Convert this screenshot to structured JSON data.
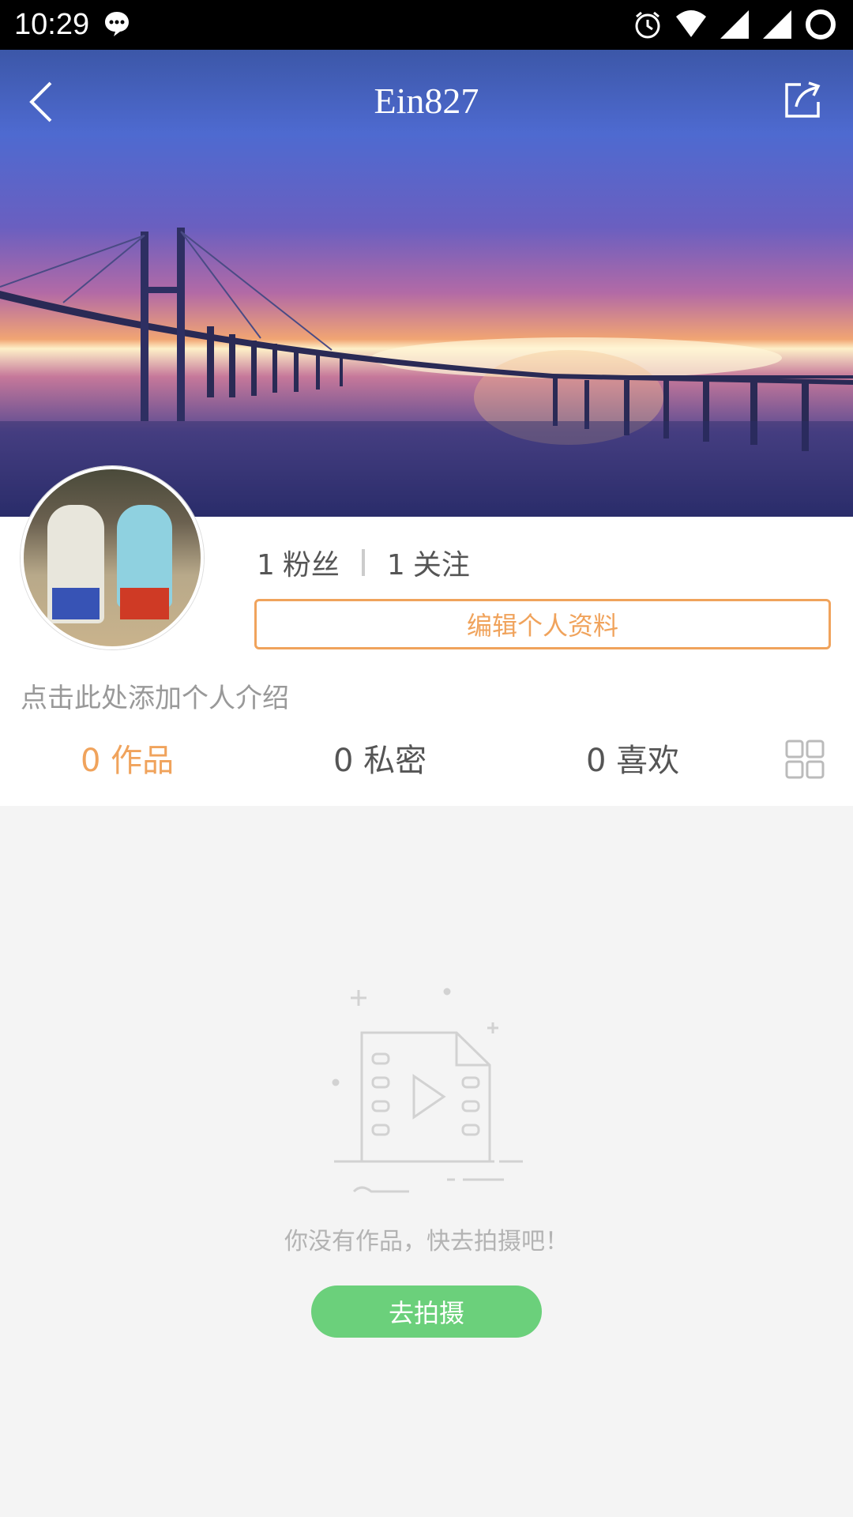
{
  "status_bar": {
    "time": "10:29",
    "icons": [
      "message-icon",
      "alarm-icon",
      "wifi-icon",
      "signal-icon",
      "signal-icon",
      "battery-icon"
    ]
  },
  "header": {
    "title": "Ein827",
    "back_icon": "chevron-left-icon",
    "share_icon": "share-icon"
  },
  "profile": {
    "followers_count": "1",
    "followers_label": "粉丝",
    "following_count": "1",
    "following_label": "关注",
    "edit_button": "编辑个人资料",
    "bio_placeholder": "点击此处添加个人介绍"
  },
  "tabs": [
    {
      "count": "0",
      "label": "作品",
      "active": true
    },
    {
      "count": "0",
      "label": "私密",
      "active": false
    },
    {
      "count": "0",
      "label": "喜欢",
      "active": false
    }
  ],
  "empty_state": {
    "message": "你没有作品，快去拍摄吧！",
    "button": "去拍摄"
  },
  "colors": {
    "accent": "#f0a35c",
    "green": "#6bd07b",
    "status_bar": "#000000"
  }
}
